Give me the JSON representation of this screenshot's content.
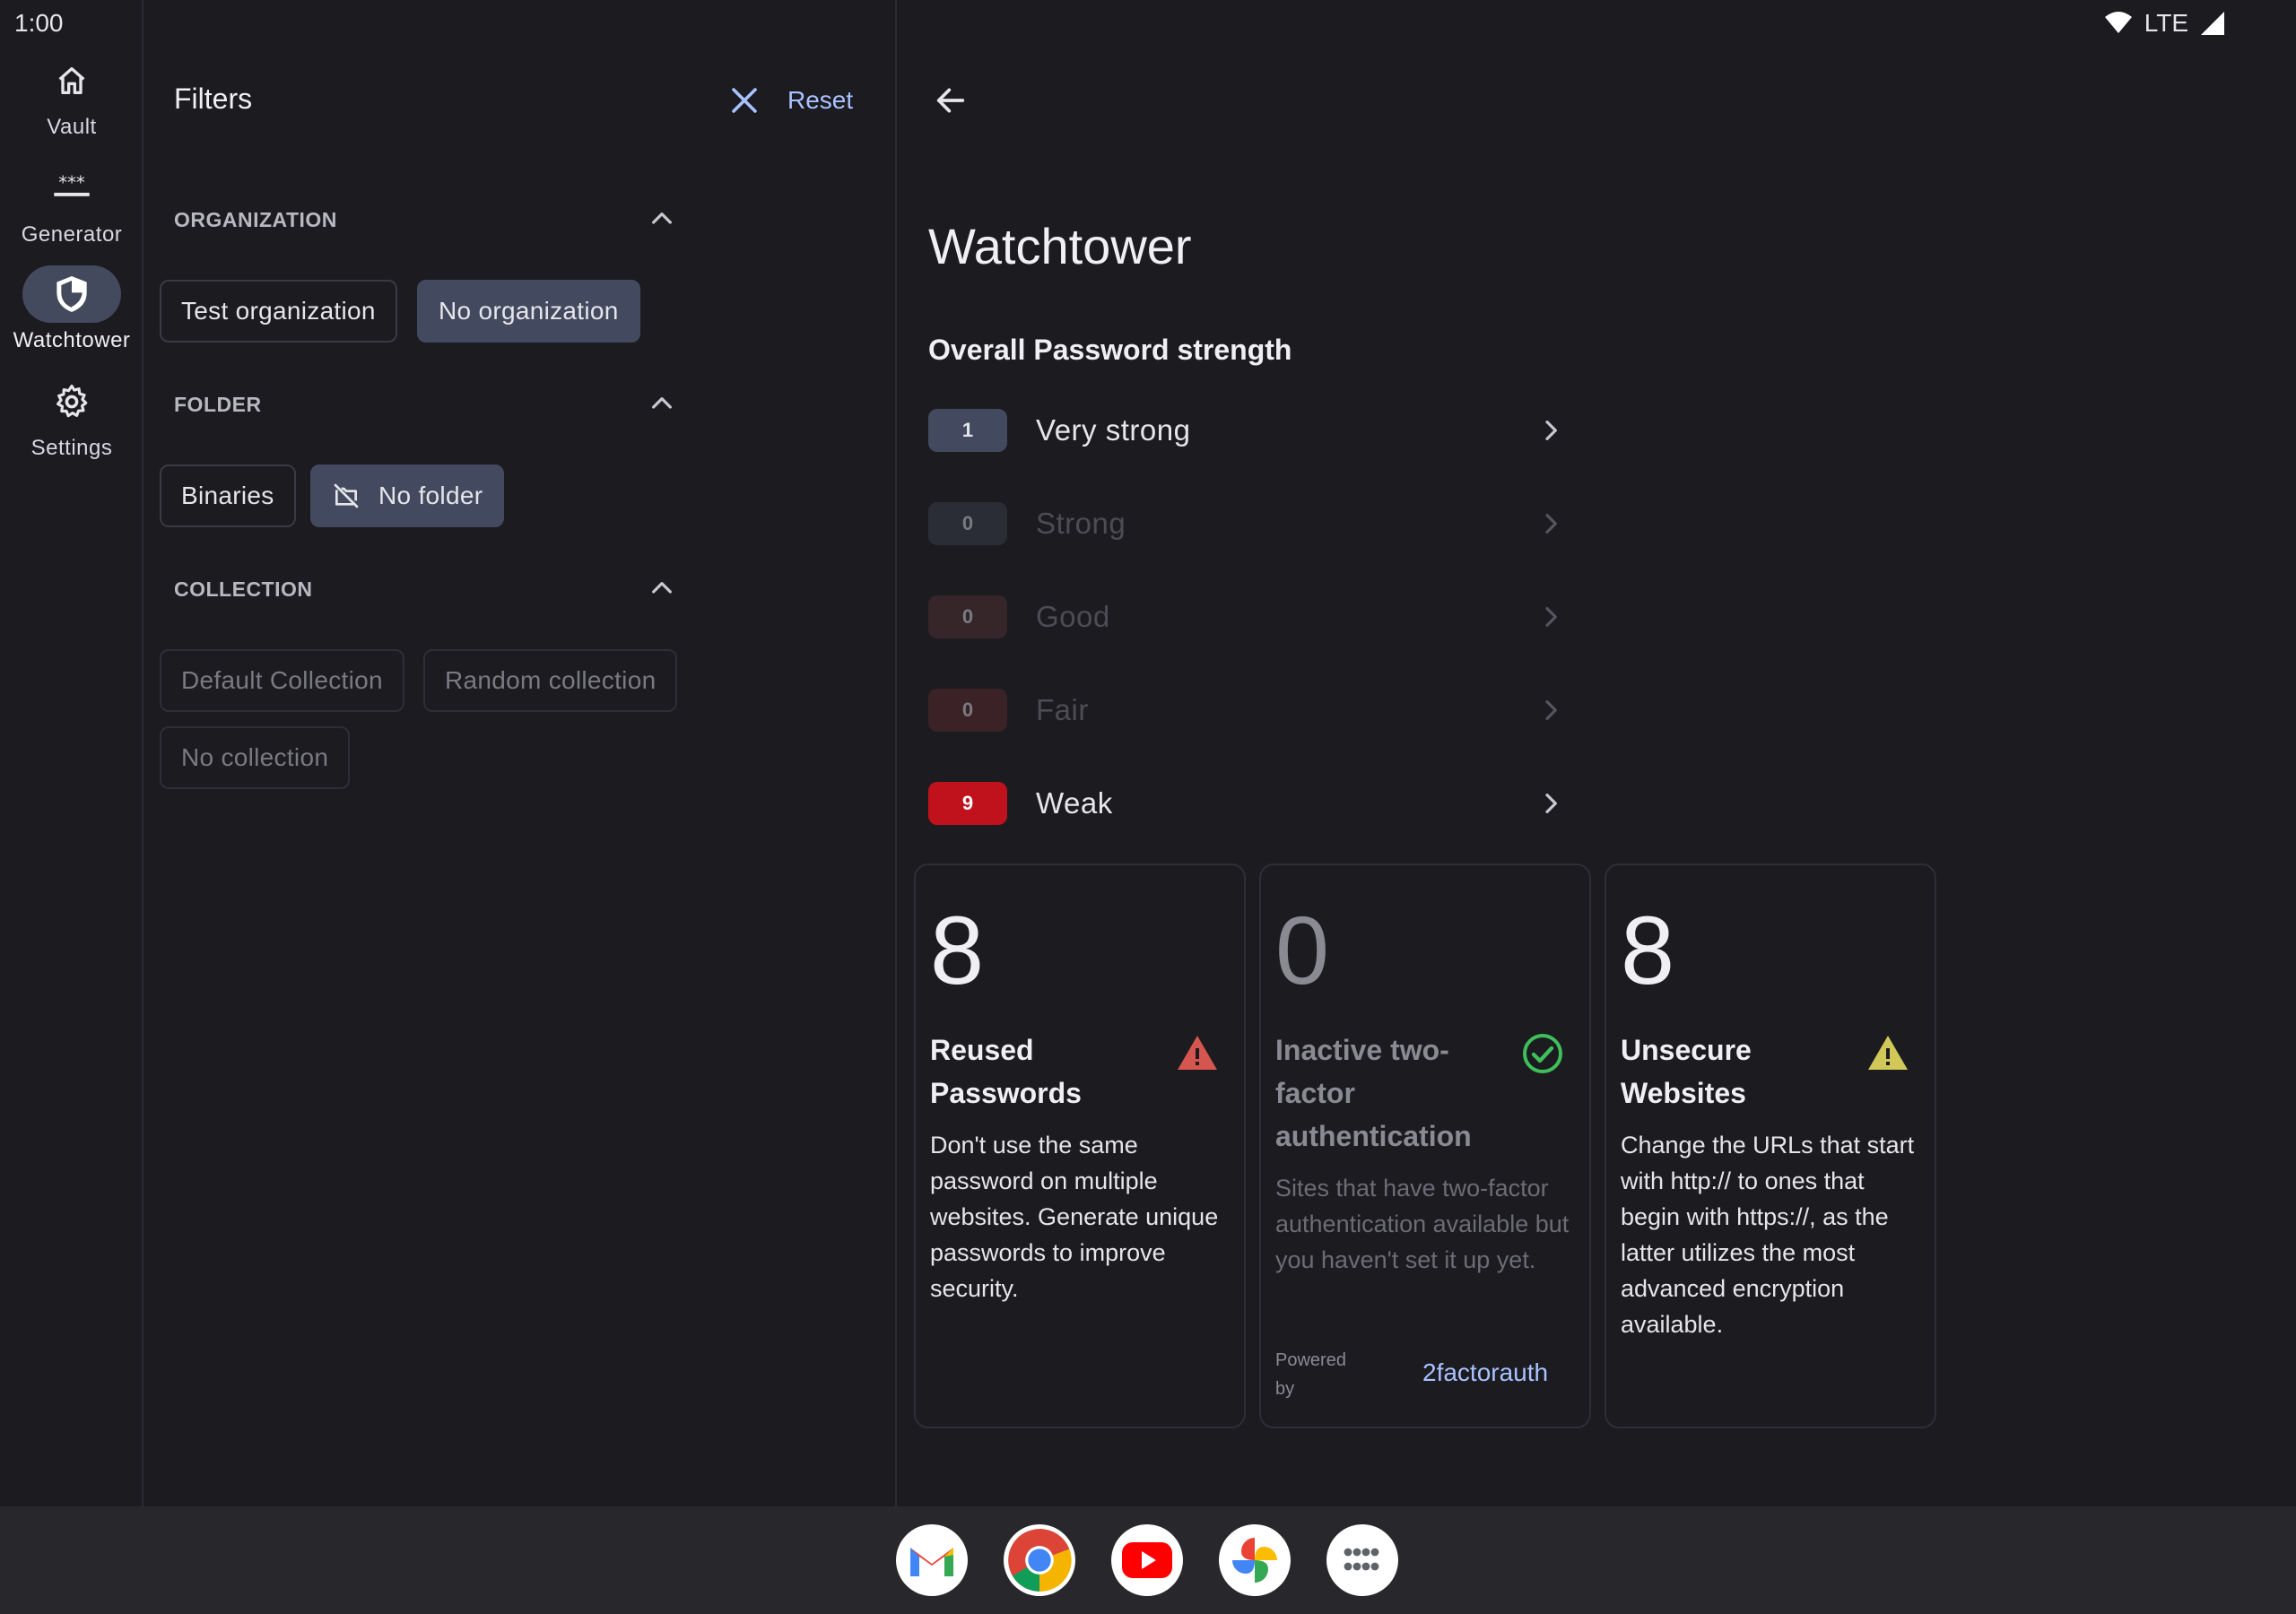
{
  "status": {
    "time": "1:00",
    "network": "LTE"
  },
  "nav_rail": {
    "items": [
      {
        "label": "Vault",
        "icon": "home-icon"
      },
      {
        "label": "Generator",
        "icon": "password-generator-icon"
      },
      {
        "label": "Watchtower",
        "icon": "shield-icon",
        "active": true
      },
      {
        "label": "Settings",
        "icon": "gear-icon"
      }
    ]
  },
  "filters": {
    "title": "Filters",
    "reset_label": "Reset",
    "sections": [
      {
        "heading": "ORGANIZATION",
        "chips": [
          {
            "label": "Test organization",
            "selected": false
          },
          {
            "label": "No organization",
            "selected": true
          }
        ]
      },
      {
        "heading": "FOLDER",
        "chips": [
          {
            "label": "Binaries",
            "selected": false
          },
          {
            "label": "No folder",
            "selected": true,
            "icon": "folder-off-icon"
          }
        ]
      },
      {
        "heading": "COLLECTION",
        "chips": [
          {
            "label": "Default Collection",
            "disabled": true
          },
          {
            "label": "Random collection",
            "disabled": true
          },
          {
            "label": "No collection",
            "disabled": true
          }
        ]
      }
    ]
  },
  "main": {
    "title": "Watchtower",
    "strength_heading": "Overall Password strength",
    "strength_rows": [
      {
        "count": "1",
        "label": "Very strong",
        "color": "#434a5f"
      },
      {
        "count": "0",
        "label": "Strong",
        "color": "#2a2d36"
      },
      {
        "count": "0",
        "label": "Good",
        "color": "#36262a"
      },
      {
        "count": "0",
        "label": "Fair",
        "color": "#3a2226"
      },
      {
        "count": "9",
        "label": "Weak",
        "color": "#c0121c"
      }
    ],
    "cards": [
      {
        "number": "8",
        "title": "Reused Passwords",
        "description": "Don't use the same password on multiple websites. Generate unique passwords to improve security.",
        "icon": "warning-triangle-icon",
        "icon_color": "#d4564e"
      },
      {
        "number": "0",
        "title": "Inactive two-factor authentication",
        "description": "Sites that have two-factor authentication available but you haven't set it up yet.",
        "icon": "check-circle-icon",
        "icon_color": "#3dbf5a",
        "powered_by_label": "Powered by",
        "powered_by_link": "2factorauth"
      },
      {
        "number": "8",
        "title": "Unsecure Websites",
        "description": "Change the URLs that start with http:// to ones that begin with https://, as the latter utilizes the most advanced encryption available.",
        "icon": "warning-triangle-icon",
        "icon_color": "#d2c85a"
      }
    ]
  },
  "taskbar": {
    "apps": [
      "gmail-icon",
      "chrome-icon",
      "youtube-icon",
      "photos-icon",
      "app-drawer-icon"
    ]
  }
}
